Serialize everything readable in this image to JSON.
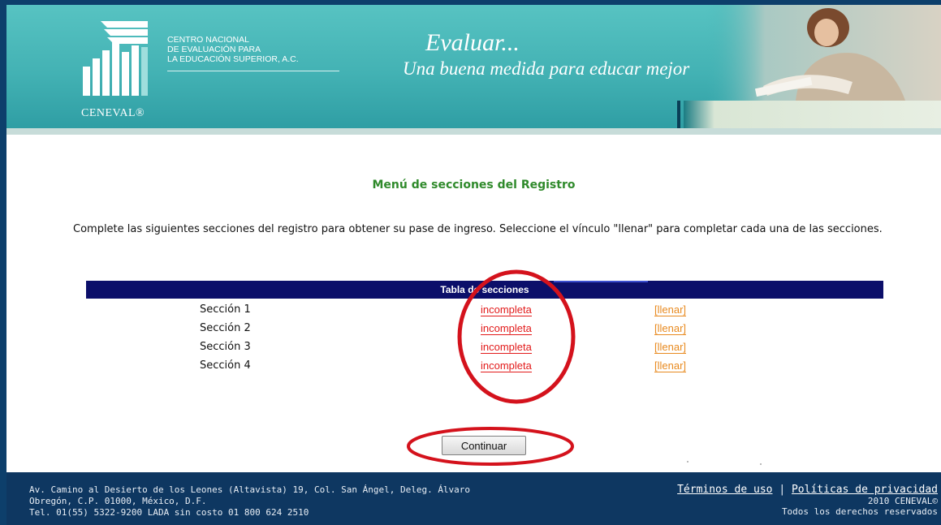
{
  "header": {
    "logo_caption": "CENEVAL®",
    "org_name": [
      "CENTRO NACIONAL",
      "DE EVALUACIÓN PARA",
      "LA EDUCACIÓN SUPERIOR, A.C."
    ],
    "slogan_line1": "Evaluar...",
    "slogan_line2": "Una buena medida para educar mejor"
  },
  "main": {
    "title": "Menú de secciones del Registro",
    "intro": "Complete las siguientes secciones del registro para obtener su pase de ingreso. Seleccione el vínculo \"llenar\" para completar cada una de las secciones.",
    "table_header": "Tabla de secciones",
    "rows": [
      {
        "section": "Sección 1",
        "status": "incompleta",
        "action": "[llenar]"
      },
      {
        "section": "Sección 2",
        "status": "incompleta",
        "action": "[llenar]"
      },
      {
        "section": "Sección 3",
        "status": "incompleta",
        "action": "[llenar]"
      },
      {
        "section": "Sección 4",
        "status": "incompleta",
        "action": "[llenar]"
      }
    ],
    "continue_label": "Continuar"
  },
  "footer": {
    "address": [
      "Av. Camino al Desierto de los Leones (Altavista) 19, Col. San Ángel, Deleg. Álvaro",
      "Obregón, C.P. 01000, México, D.F.",
      "Tel. 01(55) 5322-9200 LADA sin costo 01 800 624 2510"
    ],
    "terms_link": "Términos de uso",
    "separator": "|",
    "privacy_link": "Políticas de privacidad",
    "copyright": "2010 CENEVAL©",
    "rights": "Todos los derechos reservados"
  },
  "colors": {
    "title_green": "#2f8a2b",
    "table_header_navy": "#0c0f6a",
    "status_red": "#e21a1a",
    "action_orange": "#e88a1f",
    "annotation_red": "#d4121c",
    "footer_navy": "#0e3761",
    "banner_teal": "#43b2b4"
  }
}
